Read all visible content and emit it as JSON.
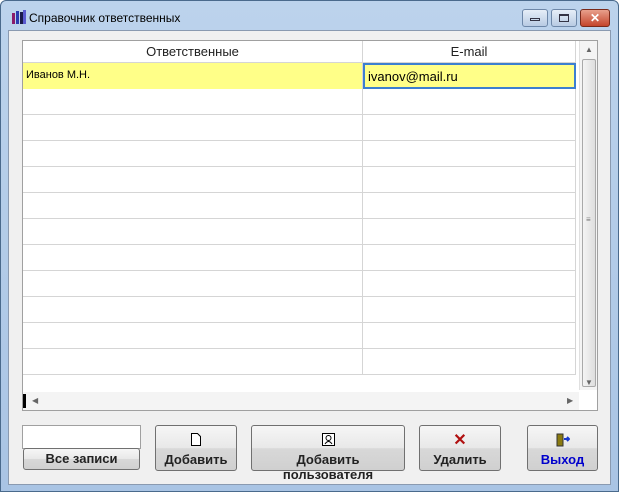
{
  "window": {
    "title": "Справочник ответственных"
  },
  "grid": {
    "columns": [
      "Ответственные",
      "E-mail"
    ],
    "rows": [
      {
        "name": "Иванов М.Н.",
        "email": "ivanov@mail.ru"
      }
    ]
  },
  "filter": {
    "value": "",
    "button": "Все записи"
  },
  "buttons": {
    "add": "Добавить",
    "add_user": "Добавить пользователя",
    "delete": "Удалить",
    "exit": "Выход"
  },
  "colors": {
    "selected_row": "#ffff88",
    "exit_text": "#0000cc",
    "delete_icon": "#b01010"
  }
}
